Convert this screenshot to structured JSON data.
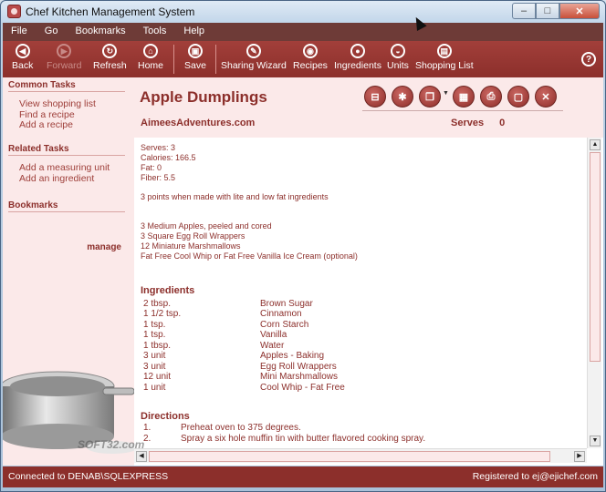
{
  "window": {
    "title": "Chef Kitchen Management System"
  },
  "menu": [
    "File",
    "Go",
    "Bookmarks",
    "Tools",
    "Help"
  ],
  "toolbar": {
    "back": "Back",
    "forward": "Forward",
    "refresh": "Refresh",
    "home": "Home",
    "save": "Save",
    "sharing_wizard": "Sharing Wizard",
    "recipes": "Recipes",
    "ingredients": "Ingredients",
    "units": "Units",
    "shopping_list": "Shopping List",
    "help": "?"
  },
  "sidebar": {
    "common_tasks": {
      "title": "Common Tasks",
      "items": [
        "View shopping list",
        "Find a recipe",
        "Add a recipe"
      ]
    },
    "related_tasks": {
      "title": "Related Tasks",
      "items": [
        "Add a measuring unit",
        "Add an ingredient"
      ]
    },
    "bookmarks": {
      "title": "Bookmarks",
      "manage": "manage"
    }
  },
  "recipe": {
    "title": "Apple Dumplings",
    "source": "AimeesAdventures.com",
    "serves_label": "Serves",
    "serves_value": "0",
    "nutrition": [
      "Serves: 3",
      "Calories: 166.5",
      "Fat: 0",
      "Fiber: 5.5"
    ],
    "note": "3 points when made with lite and low fat ingredients",
    "raw_ingredients": [
      "3 Medium Apples, peeled and cored",
      "3 Square Egg Roll Wrappers",
      "12 Miniature Marshmallows",
      "Fat Free Cool Whip or Fat Free Vanilla Ice Cream (optional)"
    ],
    "ingredients_heading": "Ingredients",
    "ingredients": [
      {
        "amount": "2 tbsp.",
        "name": "Brown Sugar"
      },
      {
        "amount": "1 1/2 tsp.",
        "name": "Cinnamon"
      },
      {
        "amount": "1 tsp.",
        "name": "Corn Starch"
      },
      {
        "amount": "1 tsp.",
        "name": "Vanilla"
      },
      {
        "amount": "1 tbsp.",
        "name": "Water"
      },
      {
        "amount": "3 unit",
        "name": "Apples - Baking"
      },
      {
        "amount": "3 unit",
        "name": "Egg Roll Wrappers"
      },
      {
        "amount": "12 unit",
        "name": "Mini Marshmallows"
      },
      {
        "amount": "1 unit",
        "name": "Cool Whip - Fat Free"
      }
    ],
    "directions_heading": "Directions",
    "directions": [
      {
        "num": "1.",
        "text": "Preheat oven to 375 degrees."
      },
      {
        "num": "2.",
        "text": "Spray a six hole muffin tin with butter flavored cooking spray."
      }
    ]
  },
  "actions": [
    "cart-icon",
    "snowflake-icon",
    "copy-icon",
    "notepad-icon",
    "print-icon",
    "lock-icon",
    "delete-icon"
  ],
  "status": {
    "left": "Connected to DENAB\\SQLEXPRESS",
    "right": "Registered to ej@ejichef.com"
  },
  "watermark": "SOFT32.com",
  "colors": {
    "accent": "#8c2f2b",
    "panel": "#fbe9e9",
    "toolbar": "#a23f3a"
  }
}
